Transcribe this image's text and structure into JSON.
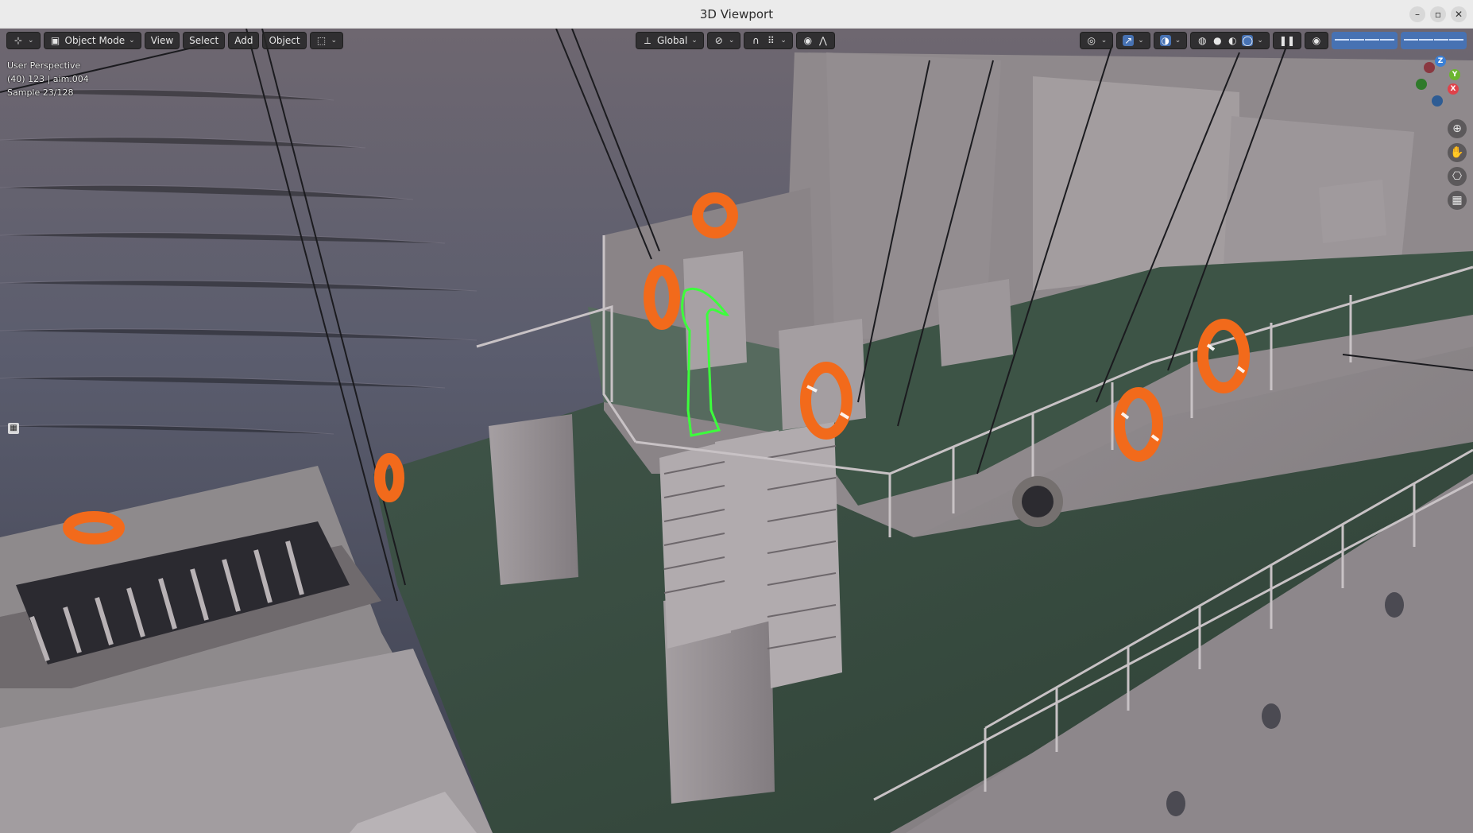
{
  "window": {
    "title": "3D Viewport",
    "controls": {
      "minimize": "–",
      "maximize": "▫",
      "close": "✕"
    }
  },
  "toolbar": {
    "editor_type_icon": "viewport-editor-icon",
    "mode": "Object Mode",
    "menus": [
      "View",
      "Select",
      "Add",
      "Object"
    ],
    "transform_orientation": "Global",
    "pause_glyph": "❚❚"
  },
  "overlay": {
    "line1": "User Perspective",
    "line2": "(40) 123 | aim.004",
    "line3": "Sample 23/128"
  },
  "gizmo": {
    "z": "Z",
    "y": "Y",
    "x": "X"
  },
  "colors": {
    "accent": "#4772b3",
    "selection_outline": "#3cff3c",
    "life_ring": "#f26a1b",
    "axis_x": "#e0424a",
    "axis_y": "#6bb530",
    "axis_z": "#3b80d6"
  }
}
